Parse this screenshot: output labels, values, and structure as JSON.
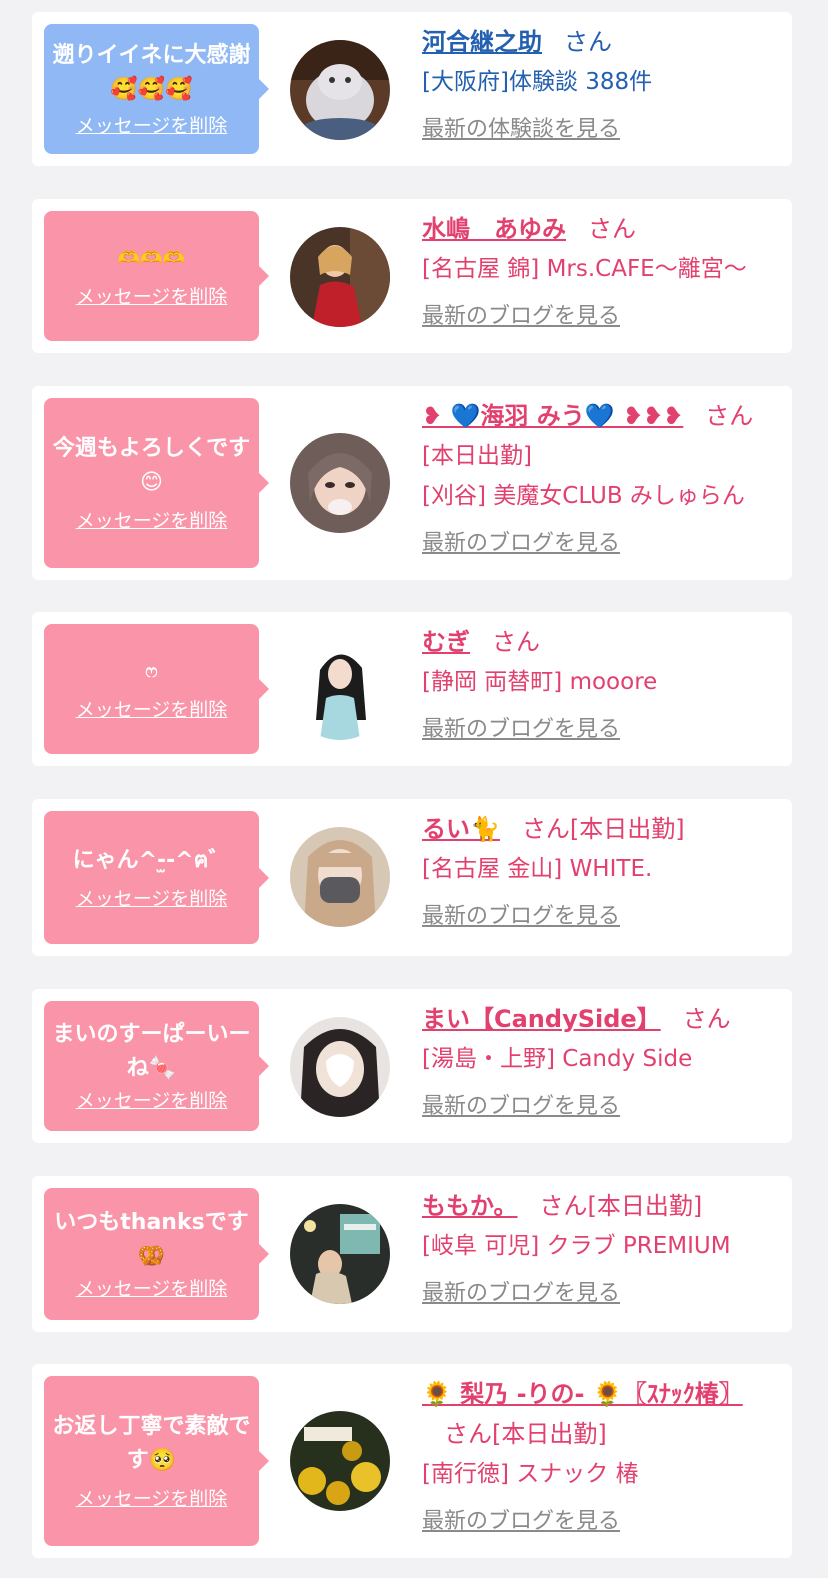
{
  "colors": {
    "bubble_blue": "#8fb8f4",
    "bubble_pink": "#fa94a8",
    "name_blue": "#2360b0",
    "name_pink": "#e2406e",
    "link_gray": "#8a8a8a"
  },
  "items": [
    {
      "message": "遡りイイネに大感謝🥰🥰🥰",
      "delete_label": "メッセージを削除",
      "name": "河合継之助",
      "suffix": "さん",
      "line1": "[大阪府]体験談 388件",
      "line2": "",
      "link": "最新の体験談を見る"
    },
    {
      "message": "🫶🫶🫶",
      "delete_label": "メッセージを削除",
      "name": "水嶋　あゆみ",
      "suffix": "さん",
      "line1": "[名古屋 錦] Mrs.CAFE〜離宮〜",
      "line2": "",
      "link": "最新のブログを見る"
    },
    {
      "message": "今週もよろしくです😊",
      "delete_label": "メッセージを削除",
      "name": "❥ 💙海羽 みう💙 ❥❥❥",
      "suffix": "さん",
      "line1": "[本日出勤]",
      "line2": "[刈谷] 美魔女CLUB みしゅらん",
      "link": "最新のブログを見る"
    },
    {
      "message": "ෆ",
      "delete_label": "メッセージを削除",
      "name": "むぎ",
      "suffix": "さん",
      "line1": "[静岡 両替町] mooore",
      "line2": "",
      "link": "最新のブログを見る"
    },
    {
      "message": "にゃん^-̫-^ฅ゛",
      "delete_label": "メッセージを削除",
      "name": "るい🐈",
      "suffix": "さん[本日出勤]",
      "line1": "[名古屋 金山] WHITE.",
      "line2": "",
      "link": "最新のブログを見る"
    },
    {
      "message": "まいのすーぱーいーね🍬",
      "delete_label": "メッセージを削除",
      "name": "まい【CandySide】",
      "suffix": "さん",
      "line1": "[湯島・上野] Candy Side",
      "line2": "",
      "link": "最新のブログを見る"
    },
    {
      "message": "いつもthanksです🥨",
      "delete_label": "メッセージを削除",
      "name": "ももか。",
      "suffix": "さん[本日出勤]",
      "line1": "[岐阜 可児] クラブ PREMIUM",
      "line2": "",
      "link": "最新のブログを見る"
    },
    {
      "message": "お返し丁寧で素敵です🥺",
      "delete_label": "メッセージを削除",
      "name": "🌻 梨乃 -りの- 🌻〖ｽﾅｯｸ椿〗",
      "suffix": "さん[本日出勤]",
      "line1": "[南行徳] スナック 椿",
      "line2": "",
      "link": "最新のブログを見る"
    }
  ]
}
